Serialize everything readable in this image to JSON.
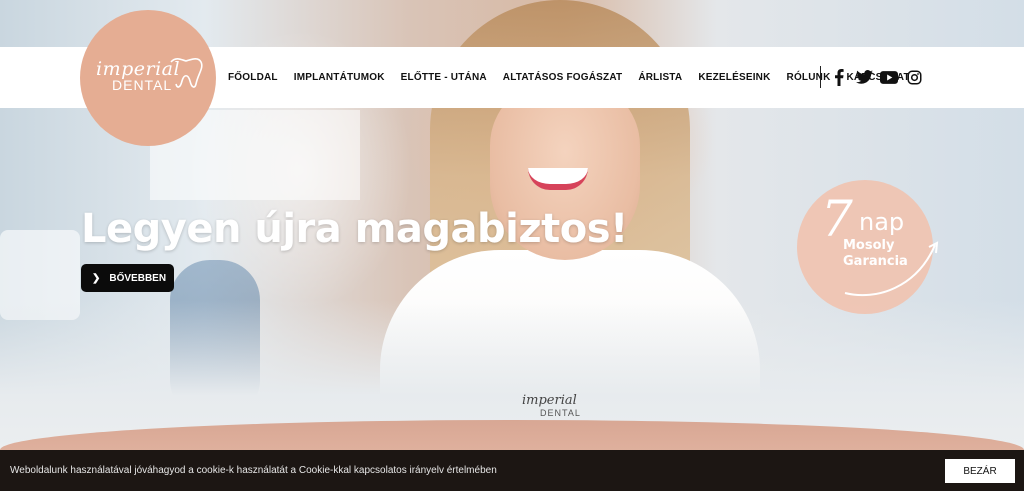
{
  "brand": {
    "logo_word1": "imperial",
    "logo_word2": "DENTAL",
    "logo_color": "#e5ad93"
  },
  "nav": {
    "items": [
      {
        "label": "FŐOLDAL"
      },
      {
        "label": "IMPLANTÁTUMOK"
      },
      {
        "label": "ELŐTTE - UTÁNA"
      },
      {
        "label": "ALTATÁSOS FOGÁSZAT"
      },
      {
        "label": "ÁRLISTA"
      },
      {
        "label": "KEZELÉSEINK"
      },
      {
        "label": "RÓLUNK"
      },
      {
        "label": "KAPCSOLAT"
      }
    ],
    "social_icons": [
      "facebook-icon",
      "twitter-icon",
      "youtube-icon",
      "instagram-icon"
    ]
  },
  "hero": {
    "headline": "Legyen újra magabiztos!",
    "button_label": "BŐVEBBEN",
    "uniform_logo_word1": "imperial",
    "uniform_logo_word2": "DENTAL"
  },
  "badge": {
    "number": "7",
    "unit": "nap",
    "line1": "Mosoly",
    "line2": "Garancia"
  },
  "cookie": {
    "text": "Weboldalunk használatával jóváhagyod a cookie-k használatát a Cookie-kkal kapcsolatos irányelv értelmében",
    "button_label": "BEZÁR"
  },
  "colors": {
    "accent": "#e5ad93",
    "cookie_bg": "#1c1613",
    "button_bg": "#0b0b0b"
  }
}
